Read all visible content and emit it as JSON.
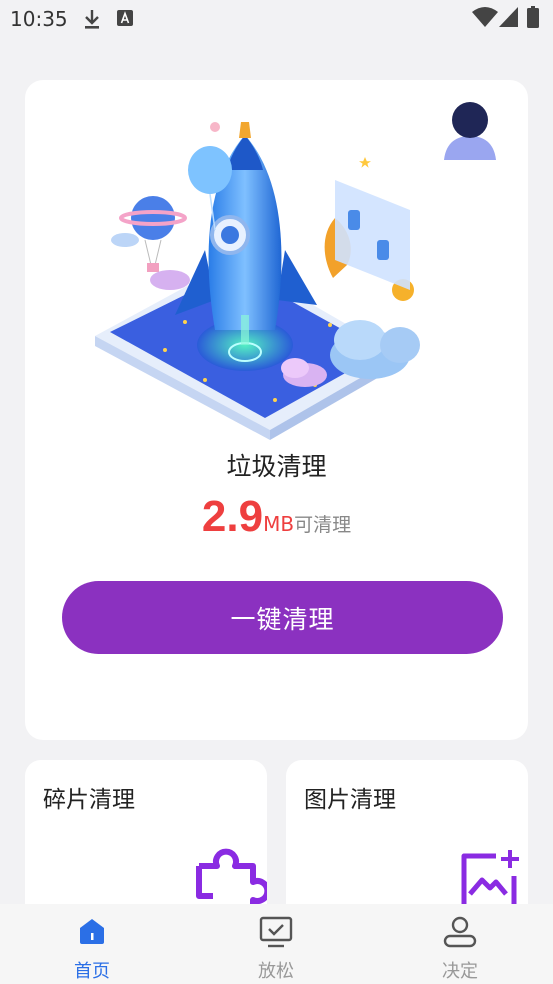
{
  "status_bar": {
    "time": "10:35",
    "icons": [
      "download-icon",
      "keyboard-a-icon",
      "wifi-icon",
      "signal-icon",
      "battery-icon"
    ]
  },
  "main_card": {
    "title": "垃圾清理",
    "size_value": "2.9",
    "size_unit": "MB",
    "size_suffix": "可清理",
    "button_label": "一键清理"
  },
  "feature_cards": [
    {
      "title": "碎片清理",
      "icon": "puzzle-icon"
    },
    {
      "title": "图片清理",
      "icon": "image-add-icon"
    }
  ],
  "tab_bar": {
    "items": [
      {
        "label": "首页",
        "icon": "home-icon",
        "active": true
      },
      {
        "label": "放松",
        "icon": "monitor-check-icon",
        "active": false
      },
      {
        "label": "决定",
        "icon": "user-icon",
        "active": false
      }
    ]
  },
  "colors": {
    "accent_purple": "#8b31c0",
    "size_red": "#ee3f3f",
    "tab_active": "#2b6fe6",
    "tab_inactive": "#999999"
  }
}
